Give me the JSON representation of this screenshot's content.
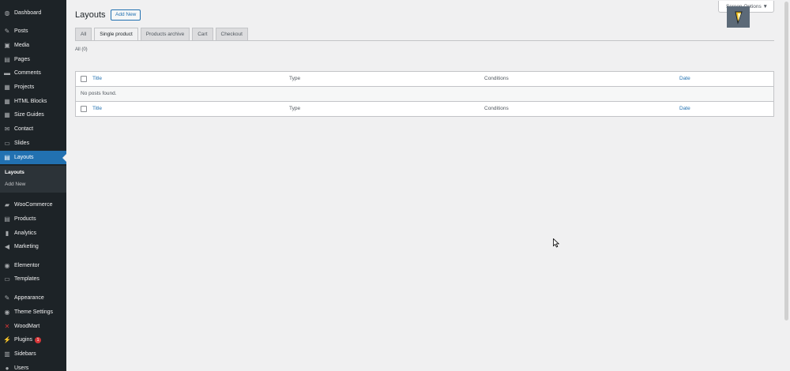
{
  "sidebar": {
    "items": [
      {
        "label": "Dashboard",
        "icon": "dashboard-icon",
        "glyph": "◍"
      },
      {
        "label": "Posts",
        "icon": "pin-icon",
        "glyph": "✎"
      },
      {
        "label": "Media",
        "icon": "media-icon",
        "glyph": "▣"
      },
      {
        "label": "Pages",
        "icon": "pages-icon",
        "glyph": "▤"
      },
      {
        "label": "Comments",
        "icon": "comments-icon",
        "glyph": "▬"
      },
      {
        "label": "Projects",
        "icon": "projects-icon",
        "glyph": "▦"
      },
      {
        "label": "HTML Blocks",
        "icon": "blocks-icon",
        "glyph": "▦"
      },
      {
        "label": "Size Guides",
        "icon": "size-guides-icon",
        "glyph": "▦"
      },
      {
        "label": "Contact",
        "icon": "mail-icon",
        "glyph": "✉"
      },
      {
        "label": "Slides",
        "icon": "slides-icon",
        "glyph": "▭"
      },
      {
        "label": "Layouts",
        "icon": "layouts-icon",
        "glyph": "▤"
      },
      {
        "label": "WooCommerce",
        "icon": "woocommerce-icon",
        "glyph": "▰"
      },
      {
        "label": "Products",
        "icon": "products-icon",
        "glyph": "▤"
      },
      {
        "label": "Analytics",
        "icon": "analytics-icon",
        "glyph": "▮"
      },
      {
        "label": "Marketing",
        "icon": "megaphone-icon",
        "glyph": "◀"
      },
      {
        "label": "Elementor",
        "icon": "elementor-icon",
        "glyph": "◉"
      },
      {
        "label": "Templates",
        "icon": "folder-icon",
        "glyph": "▭"
      },
      {
        "label": "Appearance",
        "icon": "brush-icon",
        "glyph": "✎"
      },
      {
        "label": "Theme Settings",
        "icon": "theme-settings-icon",
        "glyph": "◉"
      },
      {
        "label": "WoodMart",
        "icon": "woodmart-icon",
        "glyph": "✕"
      },
      {
        "label": "Plugins",
        "icon": "plug-icon",
        "glyph": "⚡",
        "badge": "1"
      },
      {
        "label": "Sidebars",
        "icon": "sidebars-icon",
        "glyph": "▥"
      },
      {
        "label": "Users",
        "icon": "users-icon",
        "glyph": "●"
      }
    ],
    "submenu": [
      "Layouts",
      "Add New"
    ]
  },
  "header": {
    "title": "Layouts",
    "add_new": "Add New",
    "screen_options": "Screen Options ▼"
  },
  "tabs": [
    "All",
    "Single product",
    "Products archive",
    "Cart",
    "Checkout"
  ],
  "filter": "All (0)",
  "table": {
    "columns": [
      "Title",
      "Type",
      "Conditions",
      "Date"
    ],
    "empty": "No posts found."
  },
  "colors": {
    "accent": "#2271b1",
    "sidebar": "#1d2327",
    "background": "#f0f0f1"
  }
}
